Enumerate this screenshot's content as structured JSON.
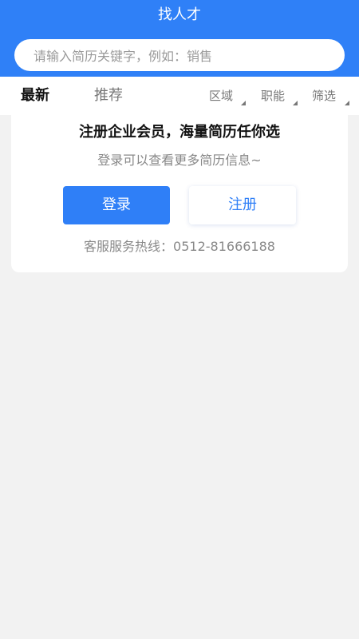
{
  "header": {
    "title": "找人才",
    "search_placeholder": "请输入简历关键字，例如：销售"
  },
  "tabs": {
    "latest": "最新",
    "recommend": "推荐"
  },
  "filters": {
    "area": "区域",
    "job": "职能",
    "screen": "筛选"
  },
  "promo": {
    "title": "注册企业会员，海量简历任你选",
    "subtitle": "登录可以查看更多简历信息~",
    "login_label": "登录",
    "register_label": "注册",
    "hotline": "客服服务热线：0512-81666188"
  },
  "colors": {
    "primary": "#2f80f7",
    "background": "#f2f2f2"
  }
}
